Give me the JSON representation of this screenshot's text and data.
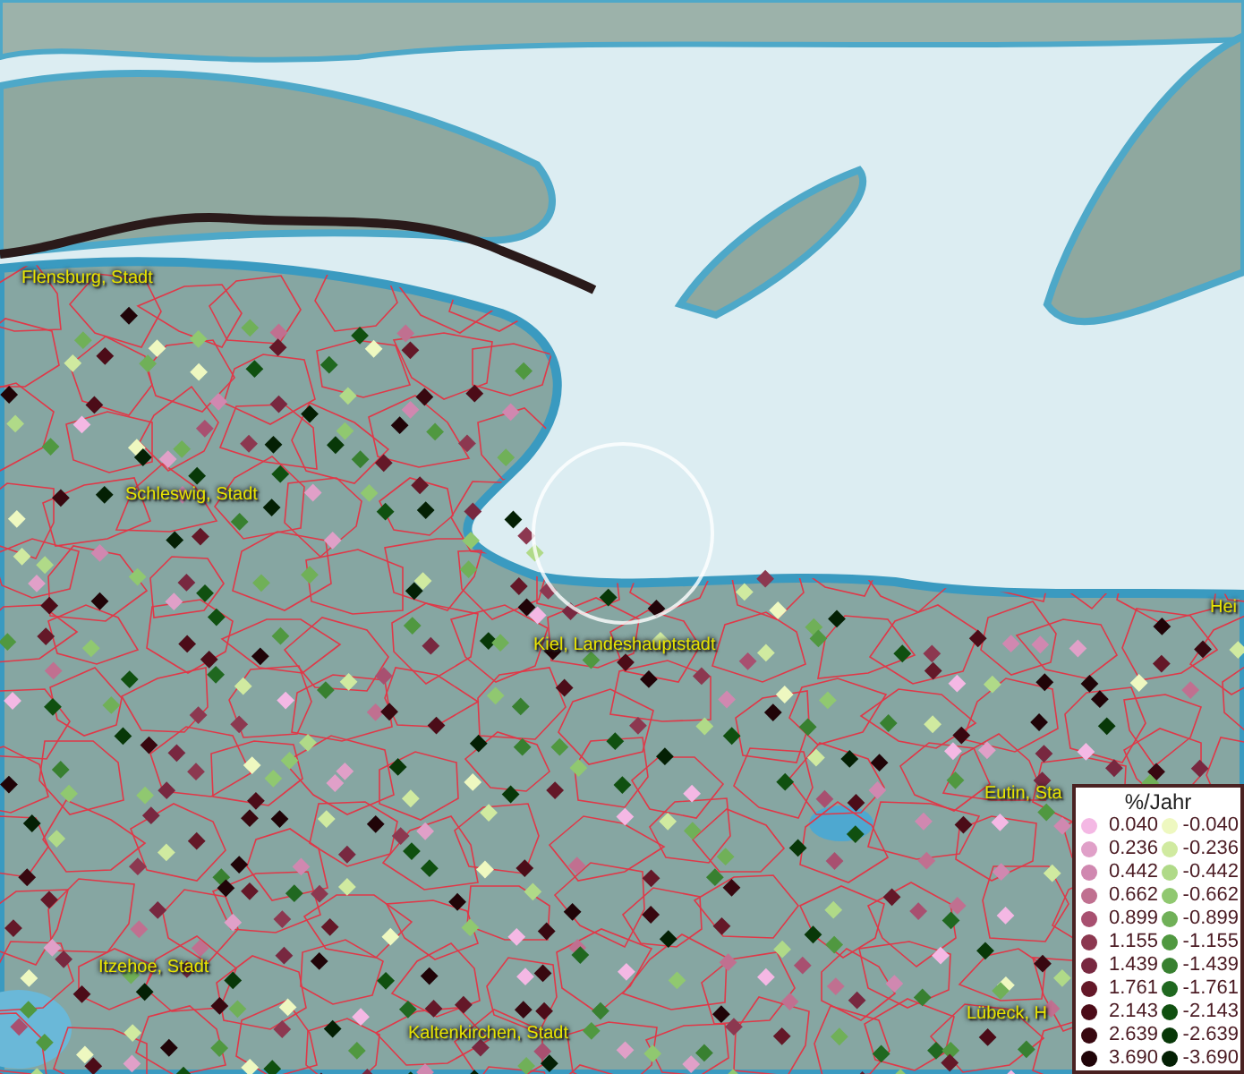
{
  "map": {
    "labels": [
      {
        "text": "Flensburg, Stadt"
      },
      {
        "text": "Schleswig, Stadt"
      },
      {
        "text": "Kiel, Landeshauptstadt"
      },
      {
        "text": "Eutin, Sta"
      },
      {
        "text": "Itzehoe, Stadt"
      },
      {
        "text": "Kaltenkirchen, Stadt"
      },
      {
        "text": "Lübeck, H"
      },
      {
        "text": "Hei"
      }
    ]
  },
  "legend": {
    "title": "%/Jahr",
    "columns": [
      {
        "items": [
          {
            "value": "0.040",
            "color": "#f4b8e4"
          },
          {
            "value": "0.236",
            "color": "#e0a0c8"
          },
          {
            "value": "0.442",
            "color": "#d088b0"
          },
          {
            "value": "0.662",
            "color": "#c07090"
          },
          {
            "value": "0.899",
            "color": "#a85070"
          },
          {
            "value": "1.155",
            "color": "#8c3850"
          },
          {
            "value": "1.439",
            "color": "#782840"
          },
          {
            "value": "1.761",
            "color": "#641828"
          },
          {
            "value": "2.143",
            "color": "#4c0c18"
          },
          {
            "value": "2.639",
            "color": "#380810"
          },
          {
            "value": "3.690",
            "color": "#200408"
          }
        ]
      },
      {
        "items": [
          {
            "value": "-0.040",
            "color": "#eef8c0"
          },
          {
            "value": "-0.236",
            "color": "#d0eaa0"
          },
          {
            "value": "-0.442",
            "color": "#b0da88"
          },
          {
            "value": "-0.662",
            "color": "#90c870"
          },
          {
            "value": "-0.899",
            "color": "#70b058"
          },
          {
            "value": "-1.155",
            "color": "#509840"
          },
          {
            "value": "-1.439",
            "color": "#388030"
          },
          {
            "value": "-1.761",
            "color": "#206820"
          },
          {
            "value": "-2.143",
            "color": "#105010"
          },
          {
            "value": "-2.639",
            "color": "#083808"
          },
          {
            "value": "-3.690",
            "color": "#042004"
          }
        ]
      }
    ]
  }
}
